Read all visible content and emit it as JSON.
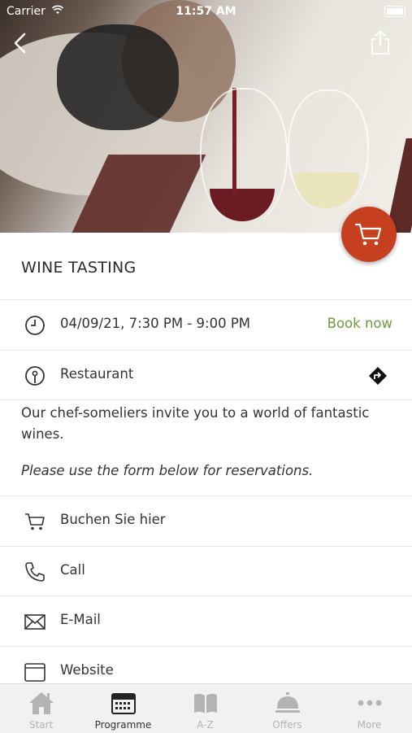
{
  "status_bar": {
    "carrier": "Carrier",
    "time": "11:57 AM"
  },
  "event": {
    "title": "WINE TASTING",
    "datetime": "04/09/21, 7:30 PM - 9:00 PM",
    "book_label": "Book now",
    "location": "Restaurant",
    "description": "Our chef-someliers invite you to a world of fantastic wines.",
    "note": "Please use the form below for reservations."
  },
  "actions": [
    {
      "label": "Buchen Sie hier",
      "icon": "cart-icon"
    },
    {
      "label": "Call",
      "icon": "phone-icon"
    },
    {
      "label": "E-Mail",
      "icon": "mail-icon"
    },
    {
      "label": "Website",
      "icon": "browser-icon"
    }
  ],
  "tabs": [
    {
      "label": "Start",
      "icon": "home-icon",
      "active": false
    },
    {
      "label": "Programme",
      "icon": "calendar-icon",
      "active": true
    },
    {
      "label": "A-Z",
      "icon": "book-icon",
      "active": false
    },
    {
      "label": "Offers",
      "icon": "service-bell-icon",
      "active": false
    },
    {
      "label": "More",
      "icon": "more-dots-icon",
      "active": false
    }
  ],
  "colors": {
    "accent": "#c6401f",
    "book_green": "#6e9a3b",
    "tab_inactive": "#b3b3b3"
  }
}
